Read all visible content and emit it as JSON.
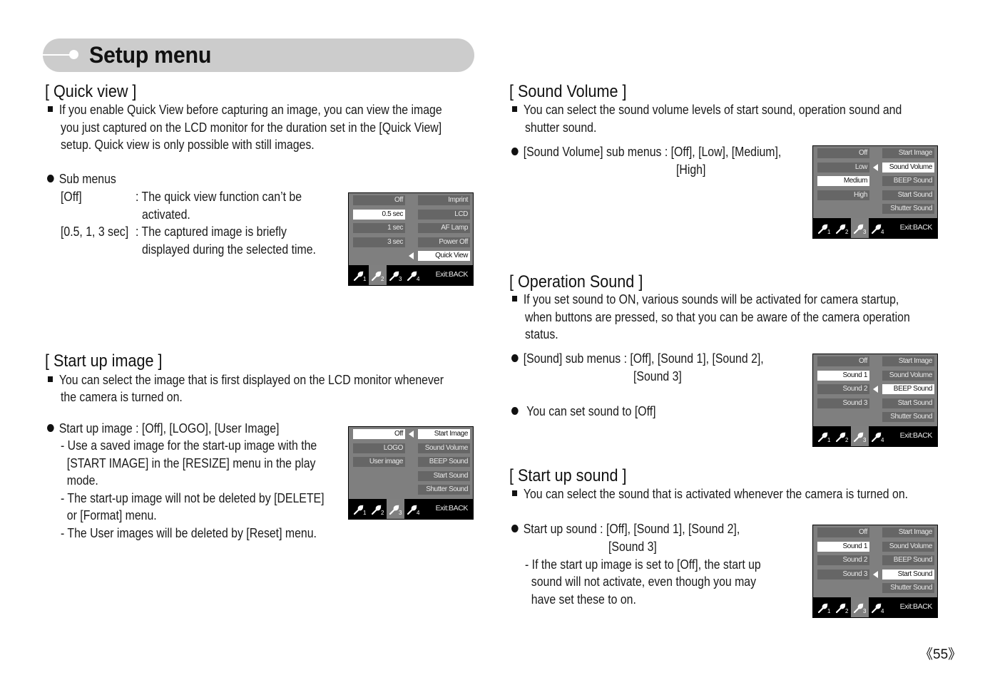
{
  "header": {
    "title": "Setup menu"
  },
  "page_number": "《55》",
  "quick_view": {
    "title": "[ Quick view ]",
    "desc": [
      "If you enable Quick View before capturing an image, you can view the image",
      "you just captured on the LCD monitor for the duration set in the [Quick View]",
      "setup. Quick view is only possible with still images."
    ],
    "sub_heading": "Sub menus",
    "sub_items": [
      {
        "key": "[Off]",
        "lines": [
          ": The quick view function can’t be",
          "activated."
        ]
      },
      {
        "key": "[0.5, 1, 3 sec]",
        "lines": [
          ": The captured image is briefly",
          "displayed during the selected time."
        ]
      }
    ],
    "lcd": {
      "options": [
        "Off",
        "0.5 sec",
        "1 sec",
        "3 sec"
      ],
      "selected_option": 1,
      "menu": [
        "Imprint",
        "LCD",
        "AF Lamp",
        "Power Off",
        "Quick View"
      ],
      "selected_menu": 4,
      "active_tab": 2,
      "tabs": [
        "1",
        "2",
        "3",
        "4"
      ],
      "exit_label": "Exit:BACK"
    }
  },
  "start_up_image": {
    "title": "[ Start up image ]",
    "desc": [
      "You can select the image that is first displayed on the LCD monitor whenever",
      "the camera is turned on."
    ],
    "bullet": "Start up image : [Off], [LOGO], [User Image]",
    "notes": [
      "- Use a saved image for the start-up image with the",
      "  [START IMAGE] in the [RESIZE] menu in the play",
      "  mode.",
      "- The start-up image will not be deleted by [DELETE]",
      "  or [Format] menu.",
      "- The User images will be deleted by [Reset] menu."
    ],
    "lcd": {
      "options": [
        "Off",
        "LOGO",
        "User image"
      ],
      "selected_option": 0,
      "menu": [
        "Start Image",
        "Sound Volume",
        "BEEP Sound",
        "Start Sound",
        "Shutter Sound"
      ],
      "selected_menu": 0,
      "active_tab": 3,
      "tabs": [
        "1",
        "2",
        "3",
        "4"
      ],
      "exit_label": "Exit:BACK"
    }
  },
  "sound_volume": {
    "title": "[ Sound Volume ]",
    "desc": [
      "You can select the sound volume levels of start sound, operation sound and",
      "shutter sound."
    ],
    "bullet": [
      "[Sound Volume] sub menus : [Off], [Low], [Medium],",
      "[High]"
    ],
    "lcd": {
      "options": [
        "Off",
        "Low",
        "Medium",
        "High"
      ],
      "selected_option": 2,
      "menu": [
        "Start Image",
        "Sound Volume",
        "BEEP Sound",
        "Start Sound",
        "Shutter Sound"
      ],
      "selected_menu": 1,
      "active_tab": 3,
      "tabs": [
        "1",
        "2",
        "3",
        "4"
      ],
      "exit_label": "Exit:BACK"
    }
  },
  "operation_sound": {
    "title": "[ Operation Sound ]",
    "desc": [
      "If you set sound to ON, various sounds will be activated for camera startup,",
      "when buttons are pressed, so that you can be aware of the camera operation",
      "status."
    ],
    "bullet": [
      "[Sound] sub menus : [Off], [Sound 1], [Sound 2],",
      "[Sound 3]"
    ],
    "bullet2": "You can set sound to [Off]",
    "lcd": {
      "options": [
        "Off",
        "Sound 1",
        "Sound 2",
        "Sound 3"
      ],
      "selected_option": 1,
      "menu": [
        "Start Image",
        "Sound Volume",
        "BEEP Sound",
        "Start Sound",
        "Shutter Sound"
      ],
      "selected_menu": 2,
      "active_tab": 3,
      "tabs": [
        "1",
        "2",
        "3",
        "4"
      ],
      "exit_label": "Exit:BACK"
    }
  },
  "start_up_sound": {
    "title": "[ Start up sound ]",
    "desc": [
      "You can select the sound that is activated whenever the camera is turned on."
    ],
    "bullet": [
      "Start up sound : [Off], [Sound 1], [Sound 2],",
      "[Sound 3]"
    ],
    "notes": [
      "- If the start up image is set to [Off], the start up",
      "  sound will not activate, even though you may",
      "  have set these to on."
    ],
    "lcd": {
      "options": [
        "Off",
        "Sound 1",
        "Sound 2",
        "Sound 3"
      ],
      "selected_option": 1,
      "menu": [
        "Start Image",
        "Sound Volume",
        "BEEP Sound",
        "Start Sound",
        "Shutter Sound"
      ],
      "selected_menu": 3,
      "active_tab": 3,
      "tabs": [
        "1",
        "2",
        "3",
        "4"
      ],
      "exit_label": "Exit:BACK"
    }
  }
}
